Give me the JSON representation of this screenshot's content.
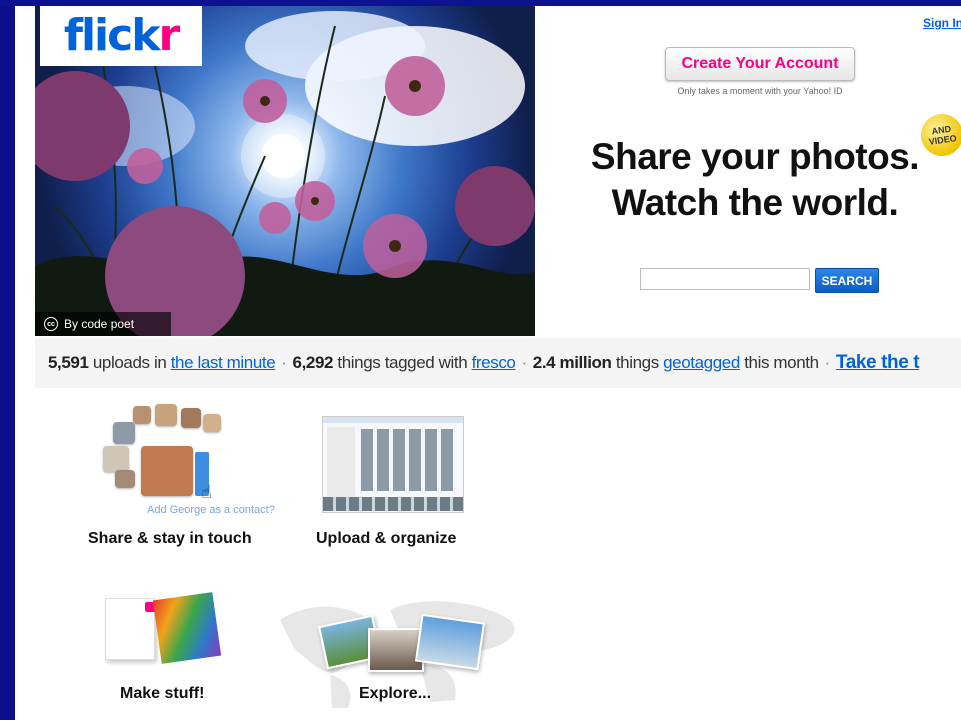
{
  "brand": {
    "logo_part1": "flick",
    "logo_part2": "r",
    "blue": "#0063dc",
    "pink": "#ff0084"
  },
  "header": {
    "sign_in": "Sign In"
  },
  "hero": {
    "photo_credit": "By code poet"
  },
  "cta": {
    "create_account": "Create Your Account",
    "subtext": "Only takes a moment with your Yahoo! ID"
  },
  "badge": {
    "line1": "AND",
    "line2": "VIDEO"
  },
  "tagline": {
    "line1": "Share your photos.",
    "line2": "Watch the world."
  },
  "search": {
    "button": "SEARCH",
    "value": ""
  },
  "stats": {
    "uploads_count": "5,591",
    "uploads_text": "uploads in",
    "uploads_link": "the last minute",
    "tagged_count": "6,292",
    "tagged_text": "things tagged with",
    "tagged_link": "fresco",
    "geo_count": "2.4 million",
    "geo_text": "things",
    "geo_link": "geotagged",
    "geo_suffix": "this month",
    "separator": "·",
    "take_tour": "Take the t"
  },
  "features": [
    {
      "label": "Share & stay in touch",
      "caption": "Add George as a contact?"
    },
    {
      "label": "Upload & organize"
    },
    {
      "label": "Make stuff!"
    },
    {
      "label": "Explore..."
    }
  ]
}
